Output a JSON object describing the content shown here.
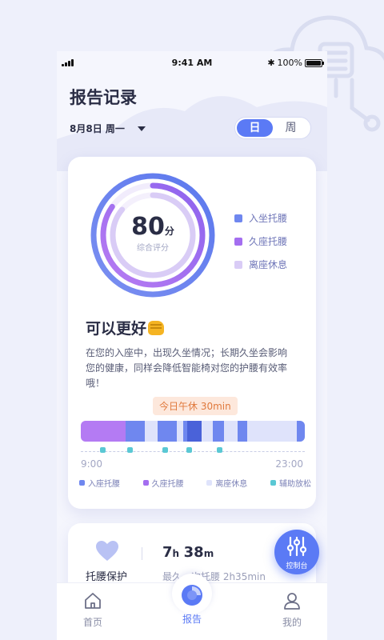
{
  "status_bar": {
    "time": "9:41 AM",
    "battery": "100%"
  },
  "header": {
    "title": "报告记录",
    "date": "8月8日 周一"
  },
  "view_toggle": {
    "day": "日",
    "week": "周",
    "selected": "day"
  },
  "score": {
    "value": "80",
    "unit": "分",
    "label": "综合评分"
  },
  "ring_legend": [
    {
      "label": "入坐托腰",
      "color": "#6f87ef"
    },
    {
      "label": "久座托腰",
      "color": "#a46ef0"
    },
    {
      "label": "离座休息",
      "color": "#d9ccf6"
    }
  ],
  "summary": {
    "headline": "可以更好",
    "description": "在您的入座中，出现久坐情况；长期久坐会影响您的健康，同样会降低智能椅对您的护腰有效率哦！"
  },
  "timeline": {
    "badge": "今日午休  30min",
    "start": "9:00",
    "end": "23:00"
  },
  "timeline_legend": [
    {
      "label": "入座托腰",
      "color": "#6f87ef"
    },
    {
      "label": "久座托腰",
      "color": "#a46ef0"
    },
    {
      "label": "离座休息",
      "color": "#dfe3fb"
    },
    {
      "label": "辅助放松",
      "color": "#5ac8d4"
    }
  ],
  "waist_card": {
    "label": "托腰保护",
    "hours": "7",
    "hours_unit": "h",
    "minutes": "38",
    "minutes_unit": "m",
    "last": "最久一次托腰 2h35min"
  },
  "fab": {
    "label": "控制台"
  },
  "tabs": [
    {
      "label": "首页"
    },
    {
      "label": "报告"
    },
    {
      "label": "我的"
    }
  ]
}
